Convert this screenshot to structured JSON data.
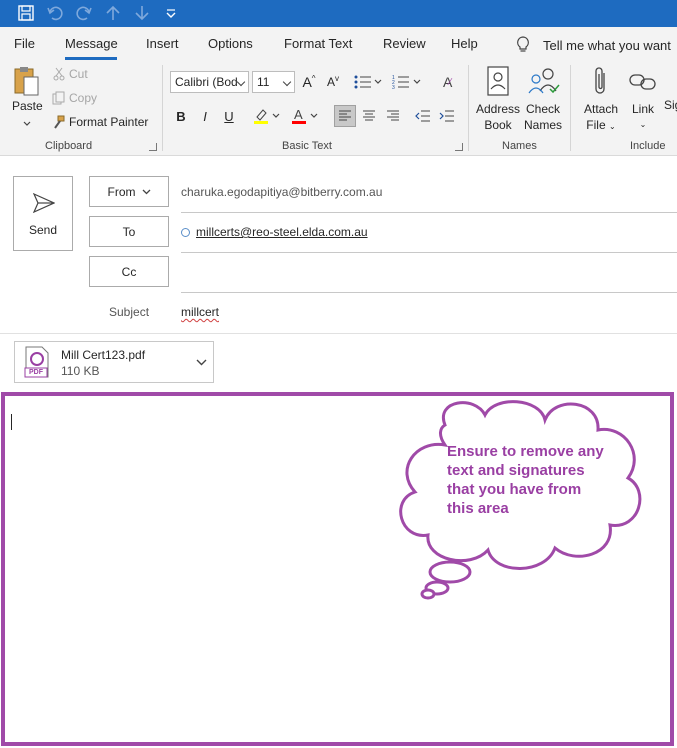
{
  "ribbon_tabs": [
    "File",
    "Message",
    "Insert",
    "Options",
    "Format Text",
    "Review",
    "Help"
  ],
  "tell_me": "Tell me what you want",
  "clipboard": {
    "paste": "Paste",
    "cut": "Cut",
    "copy": "Copy",
    "format_painter": "Format Painter",
    "group": "Clipboard"
  },
  "basic_text": {
    "font": "Calibri (Bod",
    "size": "11",
    "group": "Basic Text"
  },
  "names": {
    "address_book_1": "Address",
    "address_book_2": "Book",
    "check_names_1": "Check",
    "check_names_2": "Names",
    "group": "Names"
  },
  "include": {
    "attach_file_1": "Attach",
    "attach_file_2": "File",
    "link": "Link",
    "sig": "Sig",
    "group": "Include"
  },
  "compose": {
    "send": "Send",
    "from_label": "From",
    "from_value": "charuka.egodapitiya@bitberry.com.au",
    "to_label": "To",
    "to_value": "millcerts@reo-steel.elda.com.au",
    "cc_label": "Cc",
    "subject_label": "Subject",
    "subject_value": "millcert"
  },
  "attachment": {
    "name": "Mill Cert123.pdf",
    "size": "110 KB",
    "type_label": "PDF"
  },
  "callout": {
    "text": "Ensure to remove any text and signatures that you have from this area"
  },
  "colors": {
    "titlebar": "#1e6bc0",
    "annotation": "#a04aa8",
    "highlight": "#ffff00",
    "font_color": "#ff0000"
  }
}
